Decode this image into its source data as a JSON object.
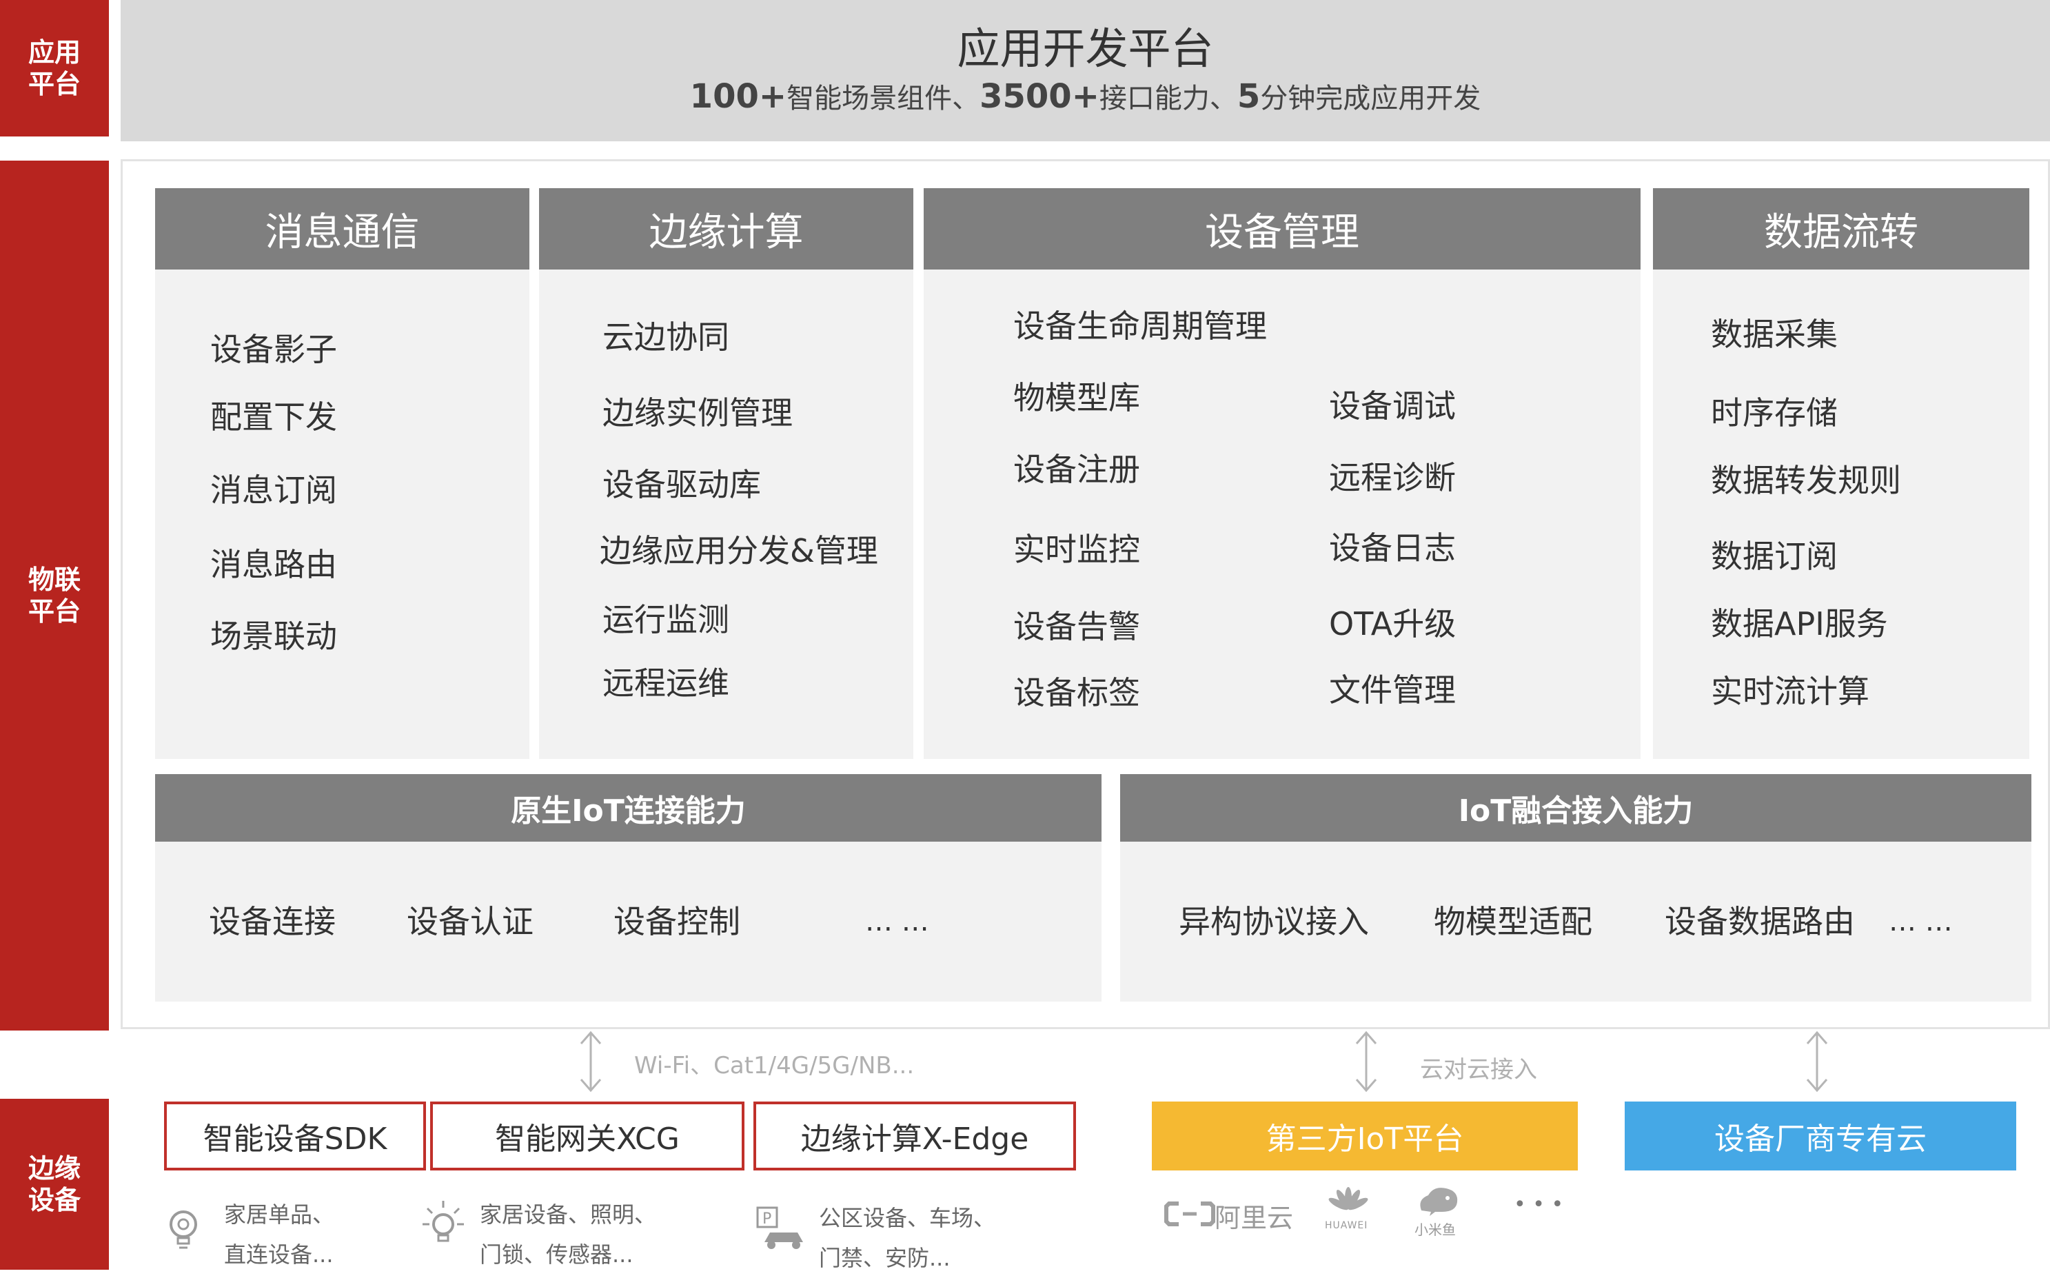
{
  "side_labels": {
    "app": "应用平台",
    "iot": "物联平台",
    "edge": "边缘设备"
  },
  "app_platform": {
    "title": "应用开发平台",
    "sub_num1": "100+",
    "sub_text1": "智能场景组件、",
    "sub_num2": "3500+",
    "sub_text2": "接口能力、",
    "sub_num3": "5",
    "sub_text3": "分钟完成应用开发"
  },
  "columns": [
    {
      "title": "消息通信",
      "items": [
        "设备影子",
        "配置下发",
        "消息订阅",
        "消息路由",
        "场景联动"
      ]
    },
    {
      "title": "边缘计算",
      "items": [
        "云边协同",
        "边缘实例管理",
        "设备驱动库",
        "边缘应用分发&管理",
        "运行监测",
        "远程运维"
      ]
    },
    {
      "title": "设备管理",
      "items": [
        "设备生命周期管理",
        "物模型库",
        "设备调试",
        "设备注册",
        "远程诊断",
        "实时监控",
        "设备日志",
        "设备告警",
        "OTA升级",
        "设备标签",
        "文件管理"
      ]
    },
    {
      "title": "数据流转",
      "items": [
        "数据采集",
        "时序存储",
        "数据转发规则",
        "数据订阅",
        "数据API服务",
        "实时流计算"
      ]
    }
  ],
  "connect_native": {
    "title": "原生IoT连接能力",
    "items": [
      "设备连接",
      "设备认证",
      "设备控制",
      "… …"
    ]
  },
  "connect_fusion": {
    "title": "IoT融合接入能力",
    "items": [
      "异构协议接入",
      "物模型适配",
      "设备数据路由",
      "… …"
    ]
  },
  "links": {
    "wifi": "Wi-Fi、Cat1/4G/5G/NB...",
    "cloud": "云对云接入"
  },
  "edge_devices": [
    {
      "label": "智能设备SDK",
      "icon": "lightbulb-icon",
      "desc1": "家居单品、",
      "desc2": "直连设备..."
    },
    {
      "label": "智能网关XCG",
      "icon": "light-rays-icon",
      "desc1": "家居设备、照明、",
      "desc2": "门锁、传感器..."
    },
    {
      "label": "边缘计算X-Edge",
      "icon": "parking-car-icon",
      "desc1": "公区设备、车场、",
      "desc2": "门禁、安防..."
    }
  ],
  "clouds": {
    "third_party": {
      "label": "第三方IoT平台",
      "color": "#f5b932"
    },
    "vendor": {
      "label": "设备厂商专有云",
      "color": "#45a8e6"
    }
  },
  "partner_logos": {
    "aliyun": "阿里云",
    "huawei": "HUAWEI",
    "xiaomi": "小米鱼",
    "more": "• • •"
  },
  "colors": {
    "accent_red": "#b7241f",
    "header_gray": "#7f7f7f",
    "panel_gray": "#f2f2f2",
    "band_gray": "#d9d9d9"
  }
}
